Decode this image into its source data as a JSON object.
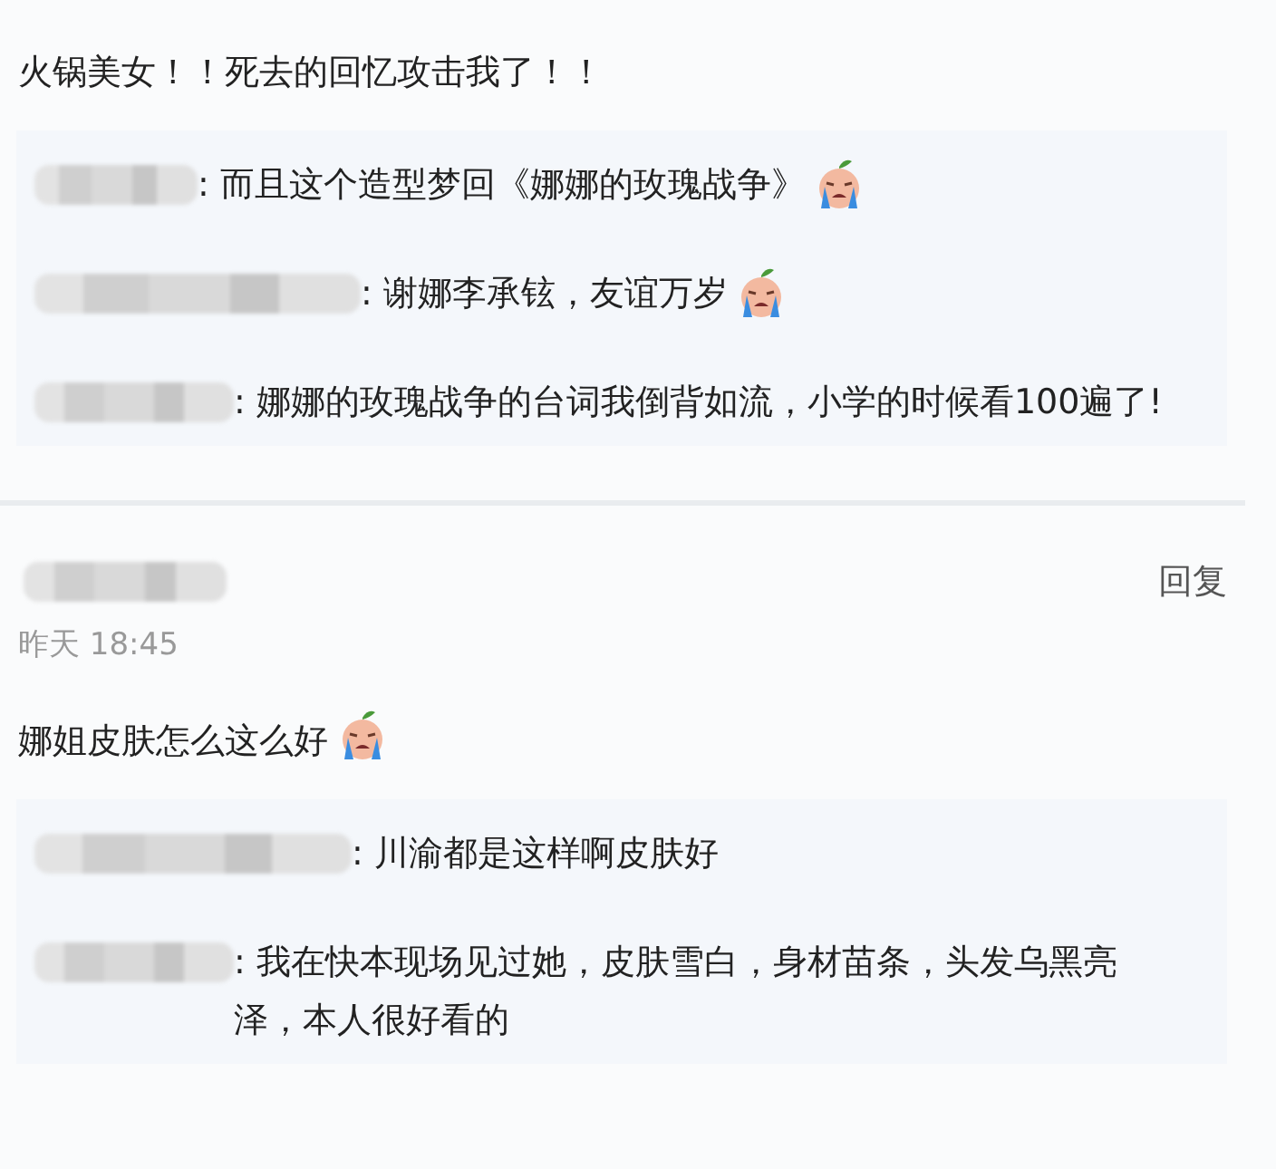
{
  "comments": [
    {
      "text": "火锅美女！！死去的回忆攻击我了！！",
      "emoji": false,
      "replies": [
        {
          "text": ": 而且这个造型梦回《娜娜的玫瑰战争》",
          "emoji": true
        },
        {
          "text": ": 谢娜李承铉，友谊万岁",
          "emoji": true
        },
        {
          "text": ": 娜娜的玫瑰战争的台词我倒背如流，小学的时候看100遍了!",
          "emoji": false
        }
      ]
    },
    {
      "time": "昨天 18:45",
      "reply_button": "回复",
      "text": "娜姐皮肤怎么这么好",
      "emoji": true,
      "replies": [
        {
          "text": ": 川渝都是这样啊皮肤好",
          "emoji": false
        },
        {
          "text": ": 我在快本现场见过她，皮肤雪白，身材苗条，头发乌黑亮泽，本人很好看的",
          "emoji": false
        }
      ]
    }
  ]
}
